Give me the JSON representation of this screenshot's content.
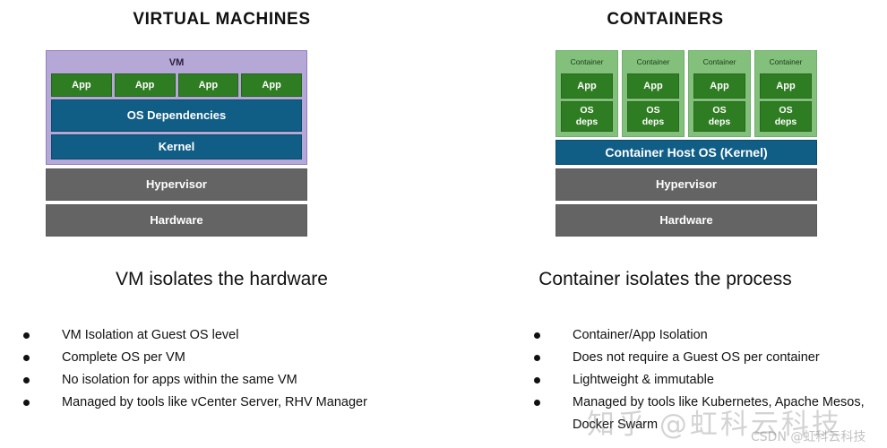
{
  "left": {
    "title": "VIRTUAL MACHINES",
    "tagline": "VM isolates the hardware",
    "stack": {
      "vm_label": "VM",
      "apps": [
        "App",
        "App",
        "App",
        "App"
      ],
      "os_dependencies": "OS Dependencies",
      "kernel": "Kernel",
      "hypervisor": "Hypervisor",
      "hardware": "Hardware"
    },
    "bullets": [
      "VM Isolation at Guest OS level",
      "Complete OS per VM",
      "No isolation for apps within the same VM",
      "Managed by tools like vCenter Server, RHV Manager"
    ]
  },
  "right": {
    "title": "CONTAINERS",
    "tagline": "Container isolates the process",
    "stack": {
      "containers": [
        {
          "caption": "Container",
          "app": "App",
          "os_deps_line1": "OS",
          "os_deps_line2": "deps"
        },
        {
          "caption": "Container",
          "app": "App",
          "os_deps_line1": "OS",
          "os_deps_line2": "deps"
        },
        {
          "caption": "Container",
          "app": "App",
          "os_deps_line1": "OS",
          "os_deps_line2": "deps"
        },
        {
          "caption": "Container",
          "app": "App",
          "os_deps_line1": "OS",
          "os_deps_line2": "deps"
        }
      ],
      "host_os": "Container Host OS (Kernel)",
      "hypervisor": "Hypervisor",
      "hardware": "Hardware"
    },
    "bullets": [
      "Container/App Isolation",
      "Does not require a Guest OS per container",
      "Lightweight & immutable",
      "Managed by tools like Kubernetes, Apache Mesos, Docker Swarm"
    ]
  },
  "watermarks": {
    "large": "知乎 @虹科云科技",
    "small": "CSDN @虹科云科技"
  },
  "colors": {
    "vm_outer": "#b5a7d6",
    "app_green": "#2f7d22",
    "teal": "#105e86",
    "gray": "#646464",
    "container_green": "#82c07c",
    "background": "#ffffff"
  }
}
